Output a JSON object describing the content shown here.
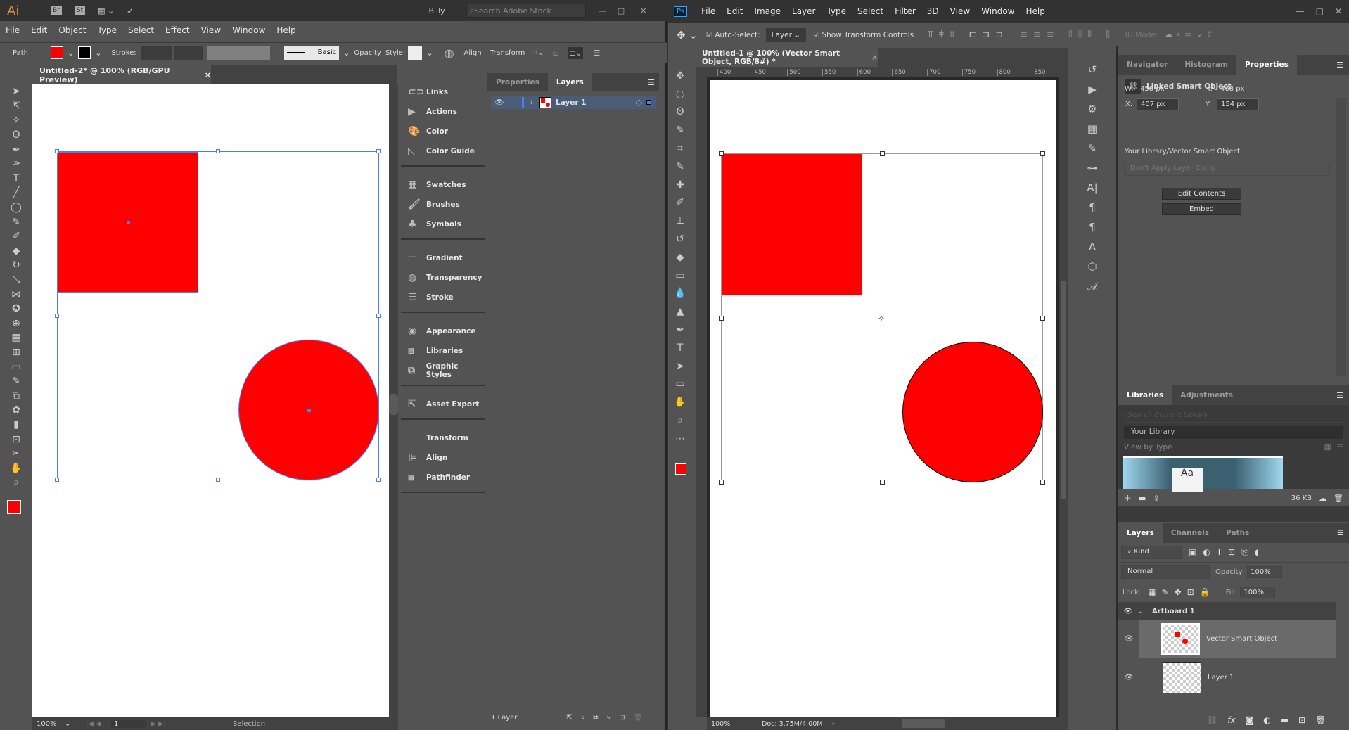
{
  "illustrator": {
    "logo": "Ai",
    "bridge": "Br",
    "stock": "St",
    "user": "Billy",
    "search_placeholder": "Search Adobe Stock",
    "menu": [
      "File",
      "Edit",
      "Object",
      "Type",
      "Select",
      "Effect",
      "View",
      "Window",
      "Help"
    ],
    "control": {
      "selection_type": "Path",
      "fill_color": "#ff0000",
      "stroke_label": "Stroke:",
      "brush": "Basic",
      "opacity_label": "Opacity",
      "style_label": "Style:",
      "align": "Align",
      "transform": "Transform"
    },
    "doc_tab": "Untitled-2* @ 100% (RGB/GPU Preview)",
    "dock": [
      [
        "Links",
        "Actions",
        "Color",
        "Color Guide"
      ],
      [
        "Swatches",
        "Brushes",
        "Symbols"
      ],
      [
        "Gradient",
        "Transparency",
        "Stroke"
      ],
      [
        "Appearance",
        "Libraries",
        "Graphic Styles"
      ],
      [
        "Asset Export"
      ],
      [
        "Transform",
        "Align",
        "Pathfinder"
      ]
    ],
    "layers_panel": {
      "tabs": [
        "Properties",
        "Layers"
      ],
      "active": "Layers",
      "layers": [
        "Layer 1"
      ],
      "footer": "1 Layer"
    },
    "status": {
      "zoom": "100%",
      "artboard": "1",
      "tool": "Selection"
    }
  },
  "photoshop": {
    "logo": "Ps",
    "menu": [
      "File",
      "Edit",
      "Image",
      "Layer",
      "Type",
      "Select",
      "Filter",
      "3D",
      "View",
      "Window",
      "Help"
    ],
    "options": {
      "auto_select": "Auto-Select:",
      "auto_select_target": "Layer",
      "show_transform": "Show Transform Controls",
      "mode_3d": "3D Mode:"
    },
    "doc_tab": "Untitled-1 @ 100% (Vector Smart Object, RGB/8#) *",
    "ruler": [
      "400",
      "450",
      "500",
      "550",
      "600",
      "650",
      "700",
      "750",
      "800",
      "850"
    ],
    "properties": {
      "tabs": [
        "Navigator",
        "Histogram",
        "Properties"
      ],
      "active": "Properties",
      "title": "Linked Smart Object",
      "w": "458 px",
      "h": "468 px",
      "x": "407 px",
      "y": "154 px",
      "w_label": "W:",
      "h_label": "H:",
      "x_label": "X:",
      "y_label": "Y:",
      "library_label": "Your Library/Vector Smart Object",
      "layer_comp": "Don't Apply Layer Comp",
      "edit_contents": "Edit Contents",
      "embed": "Embed"
    },
    "libraries": {
      "tabs": [
        "Libraries",
        "Adjustments"
      ],
      "search_placeholder": "Search Current Library",
      "library": "Your Library",
      "view": "View by Type",
      "size": "36 KB"
    },
    "layers": {
      "tabs": [
        "Layers",
        "Channels",
        "Paths"
      ],
      "kind": "Kind",
      "blend": "Normal",
      "opacity_label": "Opacity:",
      "opacity": "100%",
      "lock_label": "Lock:",
      "fill_label": "Fill:",
      "fill": "100%",
      "artboard": "Artboard 1",
      "items": [
        "Vector Smart Object",
        "Layer 1"
      ]
    },
    "status": {
      "zoom": "100%",
      "doc": "Doc: 3.75M/4.00M"
    }
  },
  "colors": {
    "fill": "#ff0000",
    "selection": "#4a7cff"
  }
}
